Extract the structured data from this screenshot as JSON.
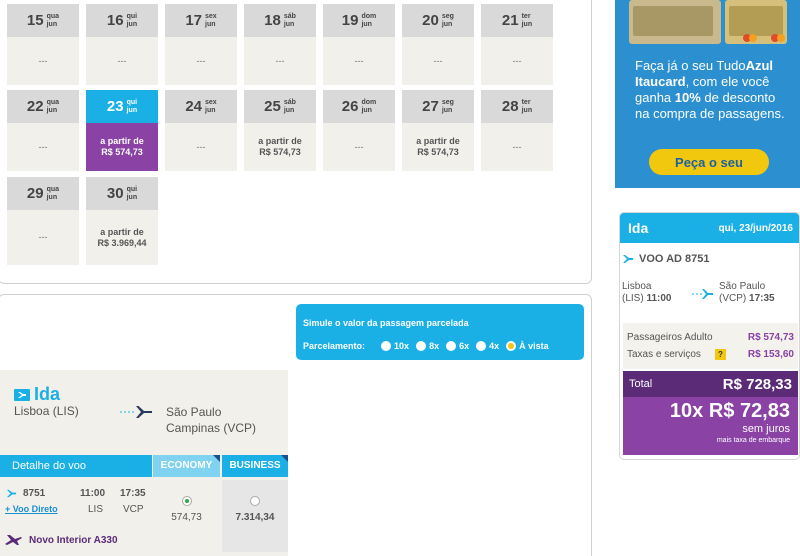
{
  "calendar": {
    "week1": [
      {
        "day": "15",
        "dow": "qua",
        "mon": "jun",
        "price": "---"
      },
      {
        "day": "16",
        "dow": "qui",
        "mon": "jun",
        "price": "---"
      },
      {
        "day": "17",
        "dow": "sex",
        "mon": "jun",
        "price": "---"
      },
      {
        "day": "18",
        "dow": "sáb",
        "mon": "jun",
        "price": "---"
      },
      {
        "day": "19",
        "dow": "dom",
        "mon": "jun",
        "price": "---"
      },
      {
        "day": "20",
        "dow": "seg",
        "mon": "jun",
        "price": "---"
      },
      {
        "day": "21",
        "dow": "ter",
        "mon": "jun",
        "price": "---"
      }
    ],
    "week2": [
      {
        "day": "22",
        "dow": "qua",
        "mon": "jun",
        "price": "---"
      },
      {
        "day": "23",
        "dow": "qui",
        "mon": "jun",
        "p1": "a partir de",
        "p2": "R$ 574,73"
      },
      {
        "day": "24",
        "dow": "sex",
        "mon": "jun",
        "price": "---"
      },
      {
        "day": "25",
        "dow": "sáb",
        "mon": "jun",
        "p1": "a partir de",
        "p2": "R$ 574,73"
      },
      {
        "day": "26",
        "dow": "dom",
        "mon": "jun",
        "price": "---"
      },
      {
        "day": "27",
        "dow": "seg",
        "mon": "jun",
        "p1": "a partir de",
        "p2": "R$ 574,73"
      },
      {
        "day": "28",
        "dow": "ter",
        "mon": "jun",
        "price": "---"
      }
    ],
    "week3": [
      {
        "day": "29",
        "dow": "qua",
        "mon": "jun",
        "price": "---"
      },
      {
        "day": "30",
        "dow": "qui",
        "mon": "jun",
        "p1": "a partir de",
        "p2": "R$ 3.969,44"
      }
    ]
  },
  "promo": {
    "line1": "Faça já o seu Tudo",
    "brand": "Azul",
    "line2": "Itaucard",
    "line2_rest": ", com ele você",
    "line3": "ganha ",
    "discount": "10%",
    "line3_rest": " de desconto",
    "line4": "na compra de passagens.",
    "button": "Peça o seu"
  },
  "summary": {
    "title": "Ida",
    "date": "qui, 23/jun/2016",
    "flight": "VOO AD 8751",
    "from_city": "Lisboa",
    "from_code": "(LIS)",
    "from_time": "11:00",
    "to_city": "São Paulo",
    "to_code": "(VCP)",
    "to_time": "17:35",
    "adult_label": "Passageiros Adulto",
    "adult_value": "R$ 574,73",
    "tax_label": "Taxas e serviços",
    "tax_help": "?",
    "tax_value": "R$ 153,60",
    "total_label": "Total",
    "total_value": "R$ 728,33",
    "installments": "10x R$ 72,83",
    "sem_juros": "sem juros",
    "mais_taxa": "mais taxa de embarque"
  },
  "simulator": {
    "title": "Simule o valor da passagem parcelada",
    "label": "Parcelamento:",
    "options": [
      "10x",
      "8x",
      "6x",
      "4x",
      "À vista"
    ],
    "selected": "À vista"
  },
  "flight_table": {
    "title": "Ida",
    "origin": "Lisboa (LIS)",
    "dest1": "São Paulo",
    "dest2": "Campinas (VCP)",
    "detail_header": "Detalhe do voo",
    "economy": "ECONOMY",
    "business": "BUSINESS",
    "number": "8751",
    "direct": "+ Voo Direto",
    "dep_time": "11:00",
    "dep_code": "LIS",
    "arr_time": "17:35",
    "arr_code": "VCP",
    "eco_price": "574,73",
    "bus_price": "7.314,34",
    "aircraft": "Novo Interior A330"
  },
  "colors": {
    "accent": "#1ab0e6",
    "purple": "#8a42a4",
    "dark_purple": "#5b2b78",
    "yellow": "#f2c80f"
  }
}
